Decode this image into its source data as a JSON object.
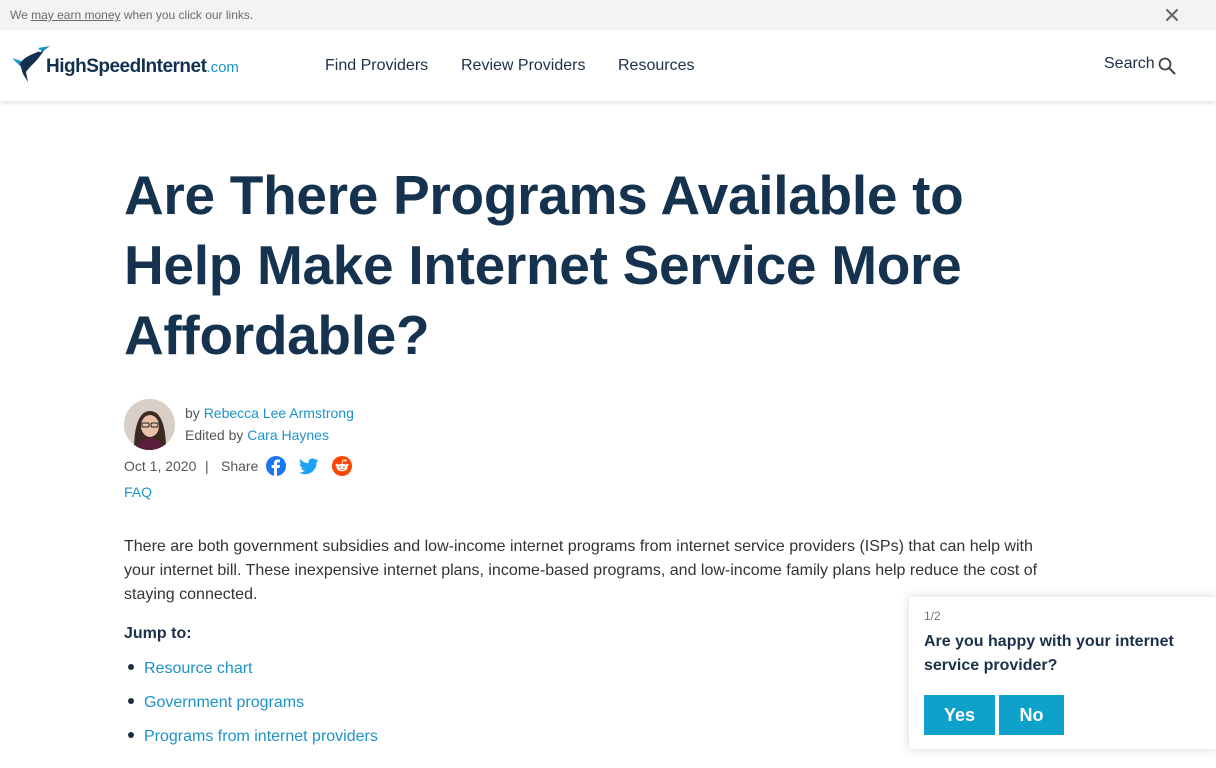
{
  "disclosure": {
    "prefix": "We ",
    "link": "may earn money",
    "suffix": " when you click our links."
  },
  "header": {
    "logo_text": "HighSpeedInternet",
    "logo_suffix": ".com",
    "nav": [
      "Find Providers",
      "Review Providers",
      "Resources"
    ],
    "search_label": "Search"
  },
  "article": {
    "title": "Are There Programs Available to Help Make Internet Service More Affordable?",
    "by_prefix": "by ",
    "author": "Rebecca Lee Armstrong",
    "edited_prefix": "Edited by ",
    "editor": "Cara Haynes",
    "date": "Oct 1, 2020",
    "separator": "|",
    "share_label": "Share",
    "share_icons": [
      "facebook-icon",
      "twitter-icon",
      "reddit-icon"
    ],
    "category": "FAQ",
    "intro": "There are both government subsidies and low-income internet programs from internet service providers (ISPs) that can help with your internet bill. These inexpensive internet plans, income-based programs, and low-income family plans help reduce the cost of staying connected.",
    "jump_label": "Jump to:",
    "jump_links": [
      "Resource chart",
      "Government programs",
      "Programs from internet providers"
    ]
  },
  "survey": {
    "step": "1/2",
    "question": "Are you happy with your internet service provider?",
    "yes": "Yes",
    "no": "No"
  },
  "colors": {
    "brand_navy": "#15334f",
    "link_blue": "#1c93c7",
    "button_blue": "#0da1cc",
    "facebook": "#1877f2",
    "twitter": "#1da1f2",
    "reddit": "#ff4500"
  }
}
